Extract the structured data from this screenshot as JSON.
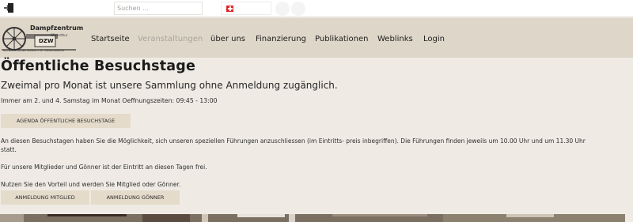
{
  "topbar": {
    "search_placeholder": "Suchen ...",
    "login_icon": "login-icon",
    "language_flag": "swiss-flag-icon"
  },
  "logo": {
    "title": "Dampfzentrum",
    "subtitle": "Winterthur",
    "badge": "DZW",
    "tagline": "Schweizerisches Museum für Industriekultur"
  },
  "nav": {
    "items": [
      {
        "label": "Startseite",
        "active": false
      },
      {
        "label": "Veranstaltungen",
        "active": true
      },
      {
        "label": "über uns",
        "active": false
      },
      {
        "label": "Finanzierung",
        "active": false
      },
      {
        "label": "Publikationen",
        "active": false
      },
      {
        "label": "Weblinks",
        "active": false
      },
      {
        "label": "Login",
        "active": false
      }
    ]
  },
  "page": {
    "title": "Öffentliche Besuchstage",
    "subtitle": "Zweimal pro Monat ist unsere Sammlung ohne Anmeldung zugänglich.",
    "hours": "Immer am 2. und 4. Samstag im Monat Oeffnungszeiten: 09:45 - 13:00",
    "agenda_button": "AGENDA ÖFFENTLICHE BESUCHSTAGE",
    "paragraph1_line1": "An diesen Besuchstagen haben Sie die Möglichkeit, sich unseren speziellen Führungen anzuschliessen (im Eintritts- preis inbegriffen). Die Führungen finden jeweils um 10.00 Uhr und um 11.30 Uhr",
    "paragraph1_line2": "statt.",
    "paragraph2": "Für unsere Mitglieder und Gönner ist der Eintritt an diesen Tagen frei.",
    "paragraph3": "Nutzen Sie den Vorteil und werden Sie Mitglied oder Gönner.",
    "member_button": "ANMELDUNG MITGLIED",
    "patron_button": "ANMELDUNG GÖNNER"
  },
  "colors": {
    "background": "#efebe4",
    "nav_band": "#ded6c8",
    "button": "#e5dbcb",
    "nav_active": "#a9a59e"
  }
}
